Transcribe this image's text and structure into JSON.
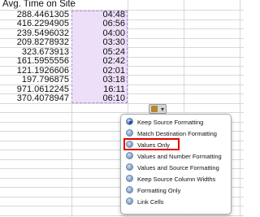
{
  "header": {
    "title": "Avg. Time on Site"
  },
  "rows": [
    {
      "value": "288.4461305",
      "time": "04:48"
    },
    {
      "value": "416.2294905",
      "time": "06:56"
    },
    {
      "value": "239.5496032",
      "time": "04:00"
    },
    {
      "value": "209.8278932",
      "time": "03:30"
    },
    {
      "value": "323.673913",
      "time": "05:24"
    },
    {
      "value": "161.5955556",
      "time": "02:42"
    },
    {
      "value": "121.1926606",
      "time": "02:01"
    },
    {
      "value": "197.796875",
      "time": "03:18"
    },
    {
      "value": "971.0612245",
      "time": "16:11"
    },
    {
      "value": "370.4078947",
      "time": "06:10"
    }
  ],
  "paste_options": {
    "button_icon": "clipboard-icon",
    "items": [
      {
        "label": "Keep Source Formatting",
        "selected": true
      },
      {
        "label": "Match Destination Formatting",
        "selected": false
      },
      {
        "label": "Values Only",
        "selected": false
      },
      {
        "label": "Values and Number Formatting",
        "selected": false
      },
      {
        "label": "Values and Source Formatting",
        "selected": false
      },
      {
        "label": "Keep Source Column Widths",
        "selected": false
      },
      {
        "label": "Formatting Only",
        "selected": false
      },
      {
        "label": "Link Cells",
        "selected": false
      }
    ],
    "highlighted": "Values Only"
  },
  "colors": {
    "selection_fill": "#ecdff7",
    "highlight_border": "#e00000"
  }
}
